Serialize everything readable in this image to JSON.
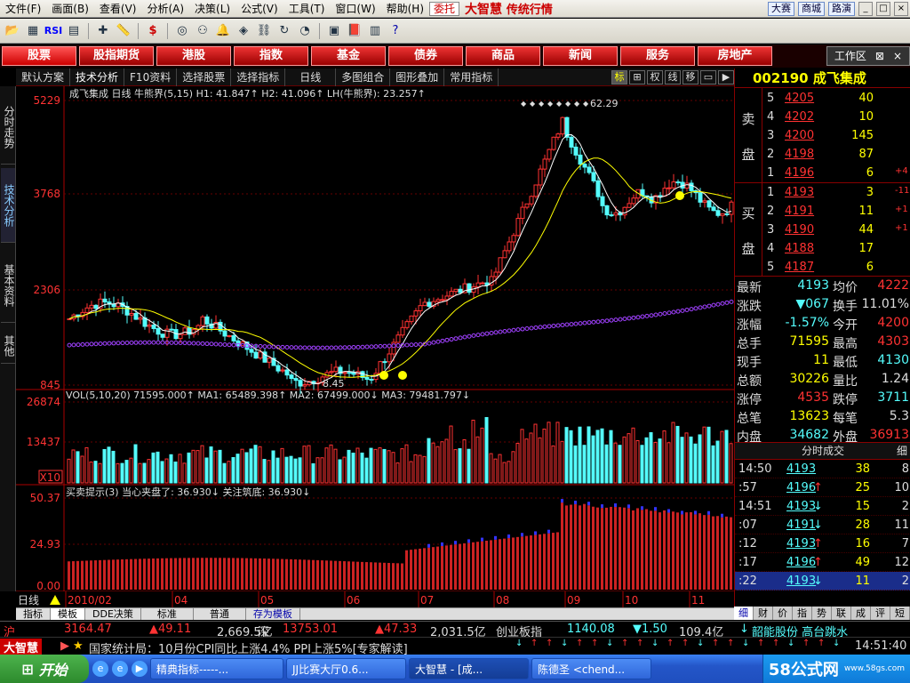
{
  "menu": {
    "items": [
      "文件(F)",
      "画面(B)",
      "查看(V)",
      "分析(A)",
      "决策(L)",
      "公式(V)",
      "工具(T)",
      "窗口(W)",
      "帮助(H)"
    ],
    "weituo": "委托",
    "brand": "大智慧",
    "mode": "传统行情",
    "buttons": [
      "大赛",
      "商城",
      "路演"
    ],
    "win_buttons": [
      "_",
      "□",
      "×"
    ]
  },
  "toolbar": {
    "icons": [
      "folder-icon",
      "chart-icon",
      "rsi-icon",
      "grid-icon",
      "cross-icon",
      "ruler-icon",
      "dollar-icon",
      "glasses-icon",
      "binoculars-icon",
      "bell-icon",
      "tag-icon",
      "link-icon",
      "refresh-icon",
      "pie-icon",
      "window-icon",
      "book-icon",
      "calendar-icon",
      "help-icon"
    ],
    "rsi_text": "RSI"
  },
  "nav": {
    "items": [
      "股票",
      "股指期货",
      "港股",
      "指数",
      "基金",
      "债券",
      "商品",
      "新闻",
      "服务",
      "房地产"
    ],
    "workarea": "工作区",
    "workarea_controls": [
      "⊠",
      "×"
    ]
  },
  "subbar": {
    "items": [
      "默认方案",
      "技术分析",
      "F10资料",
      "选择股票",
      "选择指标",
      "日线",
      "多图组合",
      "图形叠加",
      "常用指标"
    ],
    "icons": [
      "标",
      "⊞",
      "权",
      "线",
      "移",
      "▭",
      "▶"
    ]
  },
  "sidetabs": [
    "分时走势",
    "技术分析",
    "基本资料",
    "其他"
  ],
  "chart_labels": {
    "main_header": "成飞集成 日线  牛熊界(5,15)  H1: 41.847↑  H2: 41.096↑  LH(牛熊界): 23.257↑",
    "main_ticks": [
      "5229",
      "3768",
      "2306",
      "845"
    ],
    "peak_label": "62.29",
    "low_label": "8.45",
    "vol_header": "VOL(5,10,20)  71595.000↑  MA1: 65489.398↑  MA2: 67499.000↓  MA3: 79481.797↓",
    "vol_ticks": [
      "26874",
      "13437",
      "X10"
    ],
    "bs_header": "买卖提示(3)  当心夹盘了: 36.930↓  关注筑底: 36.930↓",
    "bs_ticks": [
      "50.37",
      "24.93",
      "0.00"
    ],
    "period": "日线",
    "date_labels": [
      "2010/02",
      "04",
      "05",
      "06",
      "07",
      "08",
      "09",
      "10",
      "11"
    ]
  },
  "chart_data": [
    {
      "type": "candlestick",
      "title": "成飞集成 日线",
      "indicator": "牛熊界(5,15)",
      "ylim": [
        8.45,
        62.29
      ],
      "y_ticks": [
        "5229",
        "3768",
        "2306",
        "845"
      ],
      "x_labels": [
        "2010/02",
        "04",
        "05",
        "06",
        "07",
        "08",
        "09",
        "10",
        "11"
      ],
      "annotations": {
        "high": 62.29,
        "low": 8.45
      },
      "series": [
        {
          "name": "H1",
          "last": 41.847
        },
        {
          "name": "H2",
          "last": 41.096
        },
        {
          "name": "LH(牛熊界)",
          "last": 23.257
        }
      ]
    },
    {
      "type": "bar",
      "title": "VOL(5,10,20)",
      "y_ticks": [
        "26874",
        "13437"
      ],
      "unit_label": "X10",
      "series": [
        {
          "name": "VOL",
          "last": 71595.0
        },
        {
          "name": "MA1",
          "last": 65489.398
        },
        {
          "name": "MA2",
          "last": 67499.0
        },
        {
          "name": "MA3",
          "last": 79481.797
        }
      ]
    },
    {
      "type": "bar",
      "title": "买卖提示(3)",
      "ylim": [
        0,
        50.37
      ],
      "y_ticks": [
        "50.37",
        "24.93",
        "0.00"
      ],
      "series": [
        {
          "name": "当心夹盘了",
          "last": 36.93
        },
        {
          "name": "关注筑底",
          "last": 36.93
        }
      ]
    }
  ],
  "stock": {
    "code": "002190",
    "name": "成飞集成"
  },
  "orderbook": {
    "sell_label": [
      "卖",
      "盘"
    ],
    "buy_label": [
      "买",
      "盘"
    ],
    "sell": [
      {
        "lvl": "5",
        "price": "4205",
        "vol": "40",
        "chg": ""
      },
      {
        "lvl": "4",
        "price": "4202",
        "vol": "10",
        "chg": ""
      },
      {
        "lvl": "3",
        "price": "4200",
        "vol": "145",
        "chg": ""
      },
      {
        "lvl": "2",
        "price": "4198",
        "vol": "87",
        "chg": ""
      },
      {
        "lvl": "1",
        "price": "4196",
        "vol": "6",
        "chg": "+4"
      }
    ],
    "buy": [
      {
        "lvl": "1",
        "price": "4193",
        "vol": "3",
        "chg": "-11"
      },
      {
        "lvl": "2",
        "price": "4191",
        "vol": "11",
        "chg": "+1"
      },
      {
        "lvl": "3",
        "price": "4190",
        "vol": "44",
        "chg": "+1"
      },
      {
        "lvl": "4",
        "price": "4188",
        "vol": "17",
        "chg": ""
      },
      {
        "lvl": "5",
        "price": "4187",
        "vol": "6",
        "chg": ""
      }
    ]
  },
  "quote": [
    {
      "l1": "最新",
      "v1": "4193",
      "l2": "均价",
      "v2": "4222"
    },
    {
      "l1": "涨跌",
      "v1": "▼067",
      "l2": "换手",
      "v2": "11.01%"
    },
    {
      "l1": "涨幅",
      "v1": "-1.57%",
      "l2": "今开",
      "v2": "4200"
    },
    {
      "l1": "总手",
      "v1": "71595",
      "l2": "最高",
      "v2": "4303"
    },
    {
      "l1": "现手",
      "v1": "11",
      "l2": "最低",
      "v2": "4130"
    },
    {
      "l1": "总额",
      "v1": "30226",
      "l2": "量比",
      "v2": "1.24"
    },
    {
      "l1": "涨停",
      "v1": "4535",
      "l2": "跌停",
      "v2": "3711"
    },
    {
      "l1": "总笔",
      "v1": "13623",
      "l2": "每笔",
      "v2": "5.3"
    },
    {
      "l1": "内盘",
      "v1": "34682",
      "l2": "外盘",
      "v2": "36913"
    }
  ],
  "ticks_title": "分时成交",
  "ticks_more": "细",
  "ticks": [
    {
      "t": "14:50",
      "p": "4193",
      "a": "",
      "v": "38",
      "n": "8"
    },
    {
      "t": ":57",
      "p": "4196",
      "a": "↑",
      "v": "25",
      "n": "10"
    },
    {
      "t": "14:51",
      "p": "4193",
      "a": "↓",
      "v": "15",
      "n": "2"
    },
    {
      "t": ":07",
      "p": "4191",
      "a": "↓",
      "v": "28",
      "n": "11"
    },
    {
      "t": ":12",
      "p": "4193",
      "a": "↑",
      "v": "16",
      "n": "7"
    },
    {
      "t": ":17",
      "p": "4196",
      "a": "↑",
      "v": "49",
      "n": "12"
    },
    {
      "t": ":22",
      "p": "4193",
      "a": "↓",
      "v": "11",
      "n": "2"
    }
  ],
  "rtabs": [
    "细",
    "财",
    "价",
    "指",
    "势",
    "联",
    "成",
    "评",
    "短"
  ],
  "bottabs": [
    "指标",
    "模板",
    "DDE决策",
    "标准",
    "普通",
    "存为模板"
  ],
  "status1": {
    "sh_label": "沪",
    "sh_idx": "3164.47",
    "sh_chg": "▲49.11",
    "sh_amt": "2,669.5亿",
    "sz_label": "深",
    "sz_idx": "13753.01",
    "sz_chg": "▲47.33",
    "sz_amt": "2,031.5亿",
    "cy_label": "创业板指",
    "cy_idx": "1140.08",
    "cy_chg": "▼1.50",
    "cy_amt": "109.4亿",
    "news": "韶能股份 高台跳水"
  },
  "status2": {
    "brand": "大智慧",
    "news": "国家统计局：10月份CPI同比上涨4.4% PPI上涨5%[专家解读]",
    "time": "14:51:40"
  },
  "taskbar": {
    "start": "开始",
    "tasks": [
      "精典指标-----...",
      "JJ比赛大厅0.6...",
      "大智慧 - [成...",
      "陈德圣 <chend..."
    ],
    "watermark": "58公式网",
    "watermark_url": "www.58gs.com"
  },
  "colors": {
    "up": "#ff3232",
    "down": "#54fcfc",
    "yellow": "#ffff00",
    "purple": "#a040ff",
    "navy": "#1a2d8a"
  }
}
